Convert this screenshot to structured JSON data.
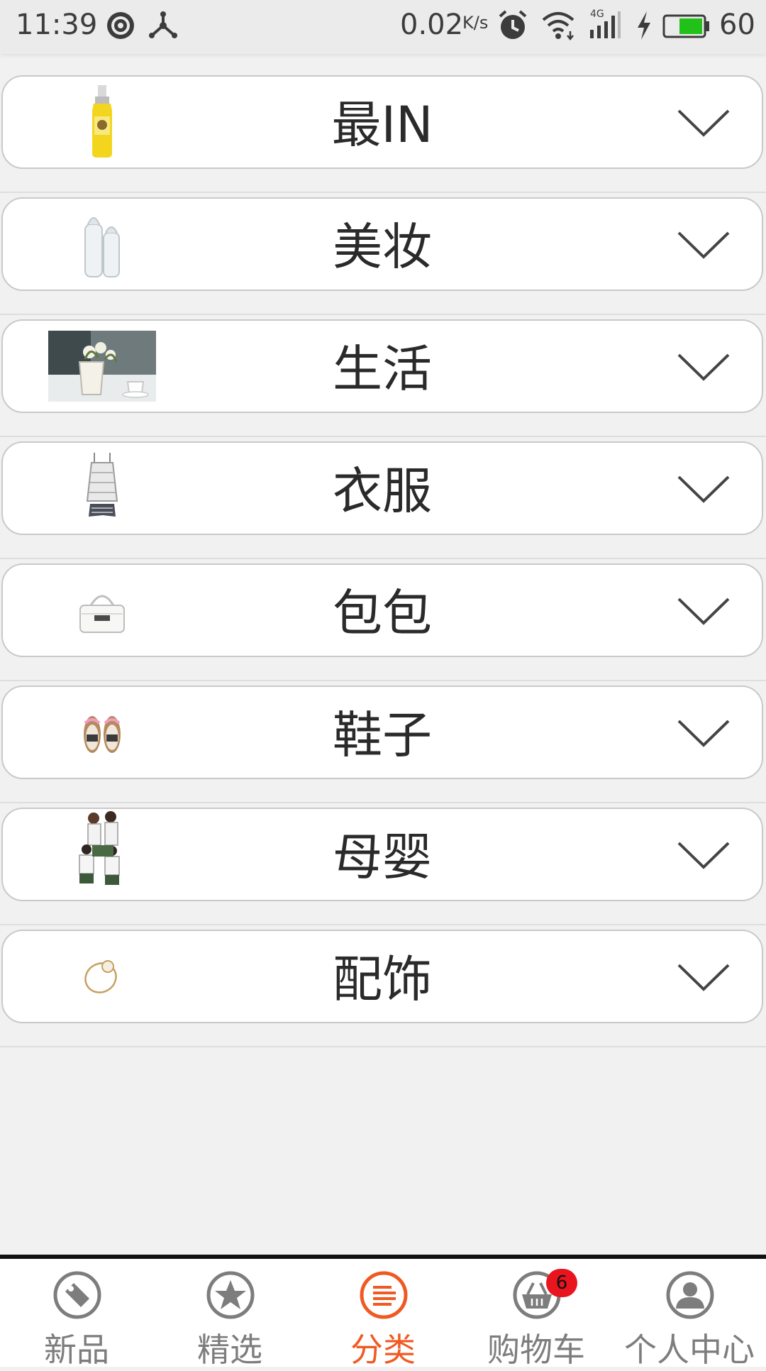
{
  "status_bar": {
    "time": "11:39",
    "speed": "0.02",
    "speed_unit": "K/s",
    "battery_percent": "60",
    "network": "4G",
    "battery_color": "#22c11a"
  },
  "categories": [
    {
      "label": "最IN",
      "thumb": "bottle-thumb"
    },
    {
      "label": "美妆",
      "thumb": "baby-bottles-thumb"
    },
    {
      "label": "生活",
      "thumb": "flower-pot-thumb"
    },
    {
      "label": "衣服",
      "thumb": "dress-thumb"
    },
    {
      "label": "包包",
      "thumb": "handbag-thumb"
    },
    {
      "label": "鞋子",
      "thumb": "sandals-thumb"
    },
    {
      "label": "母婴",
      "thumb": "family-thumb"
    },
    {
      "label": "配饰",
      "thumb": "bracelet-thumb"
    }
  ],
  "bottom_nav": {
    "items": [
      {
        "label": "新品",
        "icon": "tag-icon"
      },
      {
        "label": "精选",
        "icon": "star-icon"
      },
      {
        "label": "分类",
        "icon": "list-icon",
        "active": true
      },
      {
        "label": "购物车",
        "icon": "basket-icon",
        "badge": "6"
      },
      {
        "label": "个人中心",
        "icon": "person-icon"
      }
    ],
    "active_color": "#f05a22",
    "inactive_color": "#7d7d7d",
    "badge_color": "#e8141e"
  }
}
